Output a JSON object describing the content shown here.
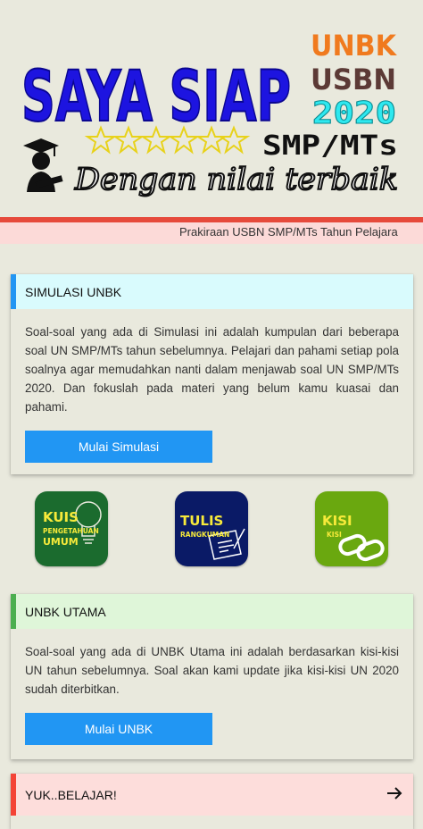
{
  "banner": {
    "headline": "SAYA SIAP",
    "exam1": "UNBK",
    "exam2": "USBN",
    "year": "2020",
    "level": "SMP/MTs",
    "tagline": "Dengan nilai terbaik"
  },
  "marquee": {
    "text": "Prakiraan USBN SMP/MTs Tahun Pelajara"
  },
  "simulasi": {
    "title": "SIMULASI UNBK",
    "description": "Soal-soal yang ada di Simulasi ini adalah kumpulan dari beberapa soal UN SMP/MTs tahun sebelumnya. Pelajari dan pahami setiap pola soalnya agar memudahkan nanti dalam menjawab soal UN SMP/MTs 2020. Dan fokuslah pada materi yang belum kamu kuasai dan pahami.",
    "button": "Mulai Simulasi"
  },
  "apps": [
    {
      "title": "KUIS",
      "subtitle1": "PENGETAHUAN",
      "subtitle2": "UMUM",
      "icon": "lightbulb-icon",
      "color": "#1b6b2e"
    },
    {
      "title": "TULIS",
      "subtitle1": "RANGKUMAN",
      "icon": "pen-paper-icon",
      "color": "#0a1a66"
    },
    {
      "title": "KISI",
      "subtitle1": "KISI",
      "icon": "chain-link-icon",
      "color": "#6aa80f"
    }
  ],
  "unbk": {
    "title": "UNBK UTAMA",
    "description": "Soal-soal yang ada di UNBK Utama ini adalah berdasarkan kisi-kisi UN tahun sebelumnya. Soal akan kami update jika kisi-kisi UN 2020 sudah diterbitkan.",
    "button": "Mulai UNBK"
  },
  "belajar": {
    "title": "YUK..BELAJAR!",
    "icon": "arrow-right-icon"
  },
  "colors": {
    "accent_blue": "#2196f3",
    "accent_green": "#4caf50",
    "accent_red": "#f44336"
  }
}
